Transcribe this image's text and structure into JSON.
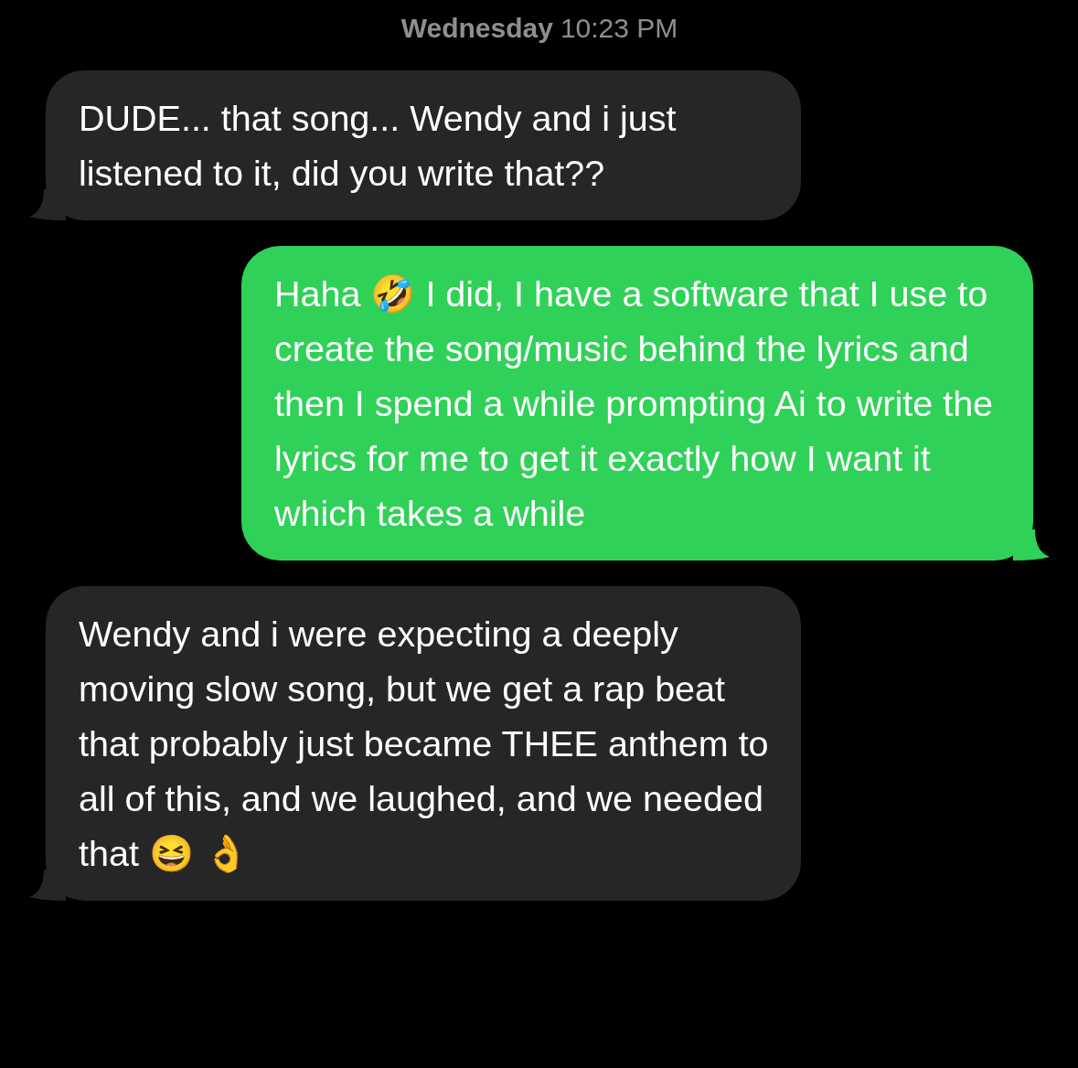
{
  "header": {
    "day": "Wednesday",
    "time": "10:23 PM"
  },
  "messages": [
    {
      "kind": "incoming",
      "text": "DUDE... that song... Wendy and i just listened to it, did you write that??"
    },
    {
      "kind": "outgoing",
      "text": "Haha 🤣 I did, I have a software that I use to create the song/music behind the lyrics and then I spend a while prompting Ai to write the lyrics for me to get it exactly how I want it which takes a while"
    },
    {
      "kind": "incoming",
      "text": "Wendy and i were expecting a deeply moving slow song, but we get a rap beat that probably just became THEE anthem to all of this, and we laughed, and we needed that 😆 👌"
    }
  ]
}
